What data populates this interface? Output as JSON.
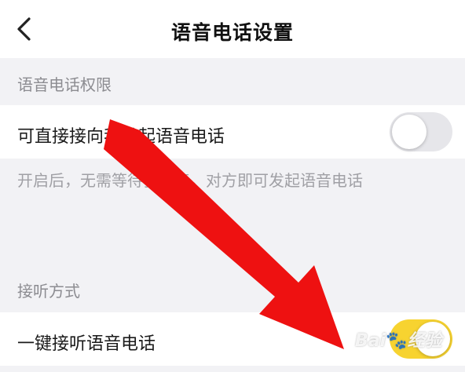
{
  "header": {
    "back_icon": "chevron-left-icon",
    "title": "语音电话设置"
  },
  "sections": [
    {
      "title": "语音电话权限",
      "item": {
        "label": "可直接接向我发起语音电话",
        "toggle_on": false
      },
      "description": "开启后，无需等待我回复，对方即可发起语音电话"
    },
    {
      "title": "接听方式",
      "item": {
        "label": "一键接听语音电话",
        "toggle_on": true
      }
    }
  ],
  "colors": {
    "toggle_on": "#f7d330",
    "toggle_off": "#e6e6ea",
    "annotation_arrow": "#ee1111"
  },
  "watermark": {
    "text": "Bai",
    "paw_icon": "paw-icon",
    "suffix": "经验"
  }
}
